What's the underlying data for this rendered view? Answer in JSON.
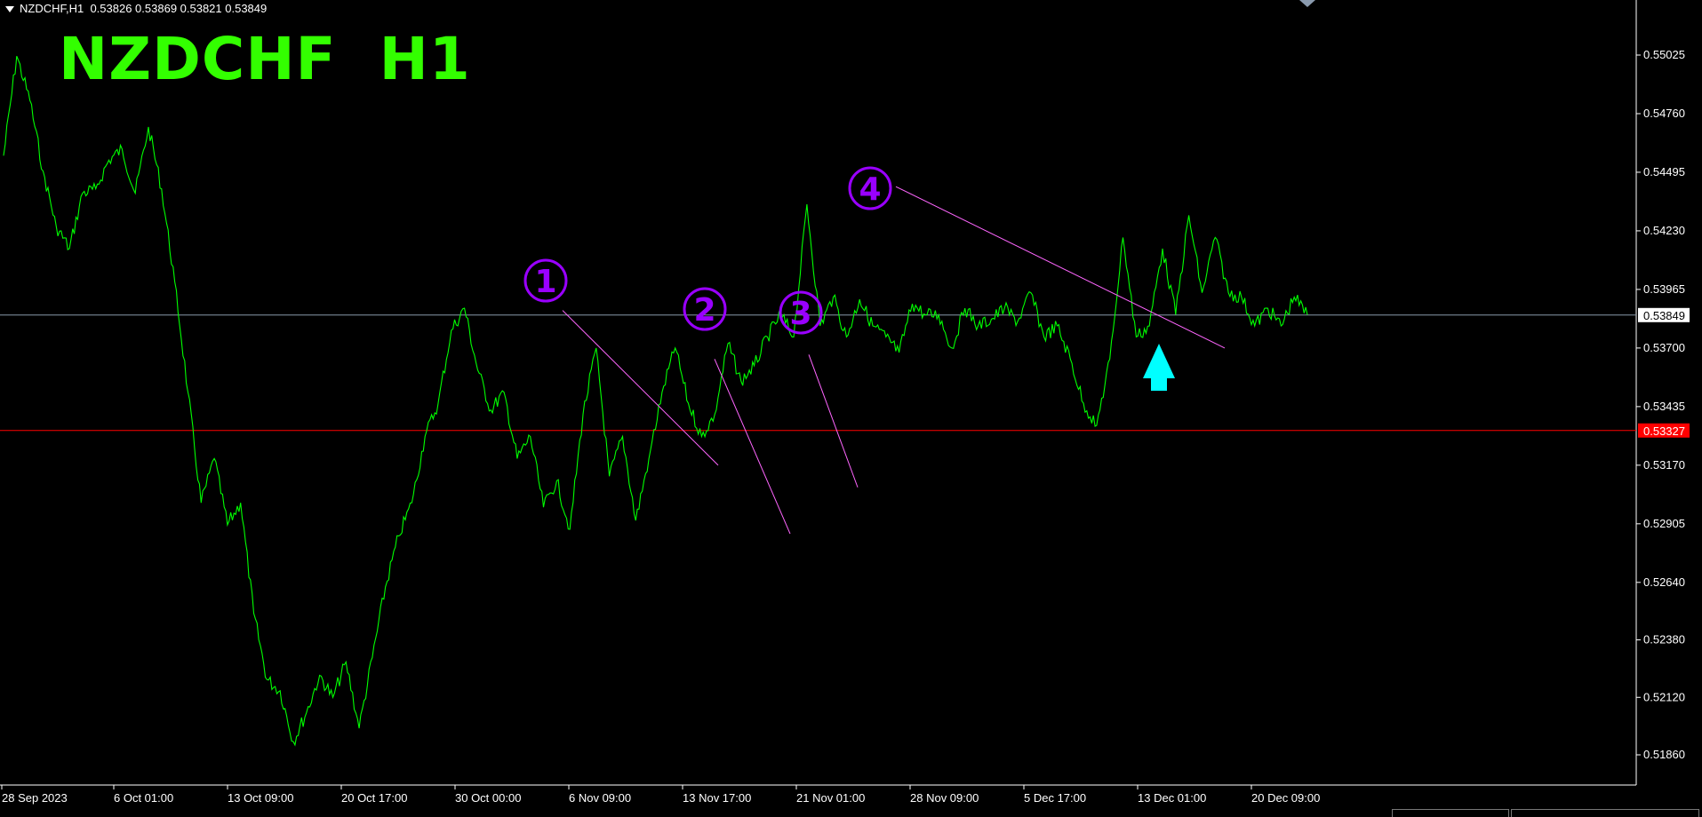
{
  "header": {
    "symbol_line": "NZDCHF,H1  0.53826 0.53869 0.53821 0.53849"
  },
  "title": "NZDCHF  H1",
  "price_axis": {
    "labels": [
      "0.55025",
      "0.54760",
      "0.54495",
      "0.54230",
      "0.53965",
      "0.53700",
      "0.53435",
      "0.53170",
      "0.52905",
      "0.52640",
      "0.52380",
      "0.52120",
      "0.51860"
    ],
    "current_price": "0.53849",
    "support_price": "0.53327"
  },
  "time_axis": {
    "labels": [
      "28 Sep 2023",
      "6 Oct 01:00",
      "13 Oct 09:00",
      "20 Oct 17:00",
      "30 Oct 00:00",
      "6 Nov 09:00",
      "13 Nov 17:00",
      "21 Nov 01:00",
      "28 Nov 09:00",
      "5 Dec 17:00",
      "13 Dec 01:00",
      "20 Dec 09:00"
    ]
  },
  "annotations": {
    "markers": [
      "1",
      "2",
      "3",
      "4"
    ],
    "arrow": "up-arrow-icon"
  },
  "colors": {
    "background": "#000000",
    "price_line": "#00ff00",
    "title": "#33ff00",
    "trendline": "#ff66ff",
    "marker": "#9900ff",
    "current_line": "#8899aa",
    "support_line": "#ff0000",
    "arrow": "#00ffff"
  },
  "chart_data": {
    "type": "line",
    "symbol": "NZDCHF",
    "timeframe": "H1",
    "ylim": [
      0.5173,
      0.5525
    ],
    "x": [
      "28 Sep 2023",
      "6 Oct 01:00",
      "13 Oct 09:00",
      "20 Oct 17:00",
      "30 Oct 00:00",
      "6 Nov 09:00",
      "13 Nov 17:00",
      "21 Nov 01:00",
      "28 Nov 09:00",
      "5 Dec 17:00",
      "13 Dec 01:00",
      "20 Dec 09:00"
    ],
    "series": [
      {
        "values": [
          0.5457,
          0.5502,
          0.5482,
          0.545,
          0.5425,
          0.5415,
          0.544,
          0.5442,
          0.5455,
          0.546,
          0.544,
          0.547,
          0.5442,
          0.54,
          0.535,
          0.53,
          0.532,
          0.529,
          0.53,
          0.525,
          0.522,
          0.5215,
          0.5192,
          0.5205,
          0.5222,
          0.5212,
          0.5228,
          0.5198,
          0.523,
          0.5262,
          0.5285,
          0.53,
          0.533,
          0.5345,
          0.5378,
          0.5388,
          0.536,
          0.5342,
          0.535,
          0.532,
          0.533,
          0.5298,
          0.531,
          0.5288,
          0.534,
          0.537,
          0.5312,
          0.533,
          0.5292,
          0.532,
          0.535,
          0.537,
          0.5345,
          0.533,
          0.534,
          0.5372,
          0.5355,
          0.5362,
          0.5375,
          0.5385,
          0.5375,
          0.5435,
          0.538,
          0.5393,
          0.5375,
          0.5392,
          0.538,
          0.5375,
          0.5368,
          0.539,
          0.5385,
          0.5385,
          0.537,
          0.5388,
          0.538,
          0.5383,
          0.5388,
          0.5382,
          0.5395,
          0.5375,
          0.538,
          0.5365,
          0.5345,
          0.5335,
          0.5365,
          0.542,
          0.5375,
          0.538,
          0.5415,
          0.5385,
          0.543,
          0.5395,
          0.542,
          0.5395,
          0.5393,
          0.538,
          0.5388,
          0.538,
          0.5393,
          0.5385
        ]
      }
    ],
    "horizontal_lines": [
      0.53849,
      0.53327
    ],
    "trendlines": [
      {
        "from": [
          0.5387,
          0.5387
        ],
        "to": [
          0.5317,
          0.5317
        ]
      },
      {
        "from": [
          0.5365,
          0.5365
        ],
        "to": [
          0.5286,
          0.5286
        ]
      },
      {
        "from": [
          0.5367,
          0.5367
        ],
        "to": [
          0.5307,
          0.5307
        ]
      },
      {
        "from": [
          0.5443,
          0.5443
        ],
        "to": [
          0.537,
          0.537
        ]
      }
    ]
  }
}
